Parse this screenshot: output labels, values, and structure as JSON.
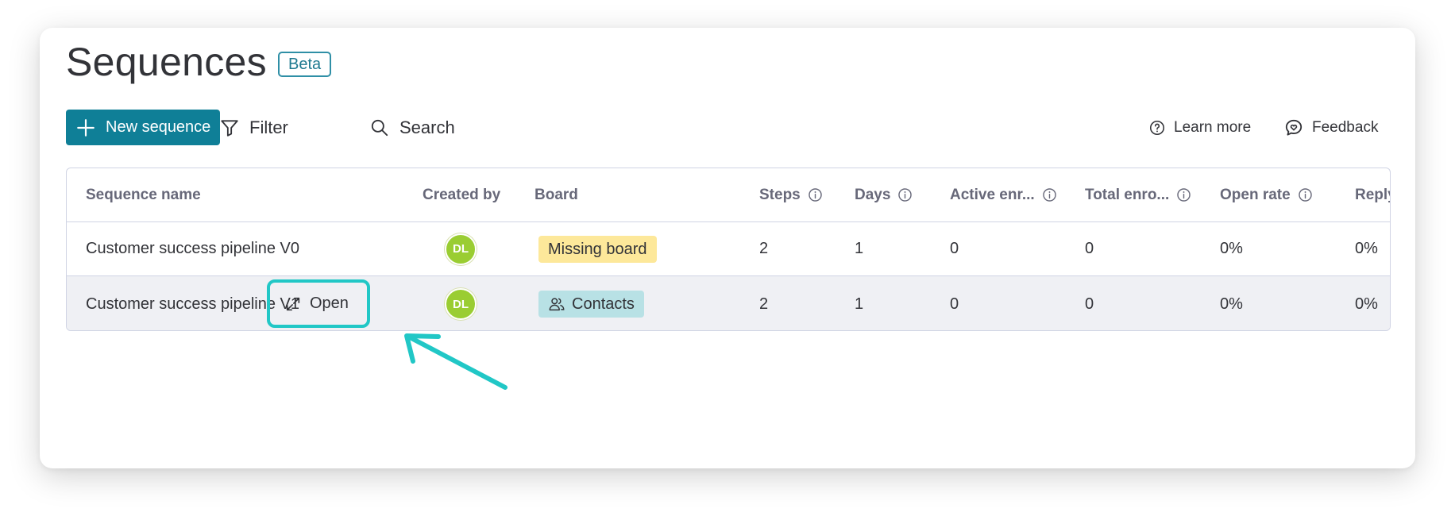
{
  "page": {
    "title": "Sequences",
    "badge": "Beta"
  },
  "toolbar": {
    "new_sequence": "New sequence",
    "filter": "Filter",
    "search": "Search",
    "learn_more": "Learn more",
    "feedback": "Feedback"
  },
  "table": {
    "columns": [
      "Sequence name",
      "Created by",
      "Board",
      "Steps",
      "Days",
      "Active enr...",
      "Total enro...",
      "Open rate",
      "Reply"
    ],
    "rows": [
      {
        "name": "Customer success pipeline V0",
        "creator": "DL",
        "board": "Missing board",
        "steps": "2",
        "days": "1",
        "active": "0",
        "total": "0",
        "open_rate": "0%",
        "reply": "0%"
      },
      {
        "name": "Customer success pipeline V1",
        "open_action": "Open",
        "creator": "DL",
        "board": "Contacts",
        "steps": "2",
        "days": "1",
        "active": "0",
        "total": "0",
        "open_rate": "0%",
        "reply": "0%"
      }
    ]
  },
  "colors": {
    "primary": "#0f7f97",
    "highlight": "#21c7c6",
    "avatar": "#9acd32",
    "missing_board": "#fde89a",
    "contacts_board": "#b8e1e5"
  },
  "icons": [
    "plus-icon",
    "filter-icon",
    "search-icon",
    "help-circle-icon",
    "feedback-icon",
    "info-icon",
    "expand-icon",
    "people-icon"
  ]
}
